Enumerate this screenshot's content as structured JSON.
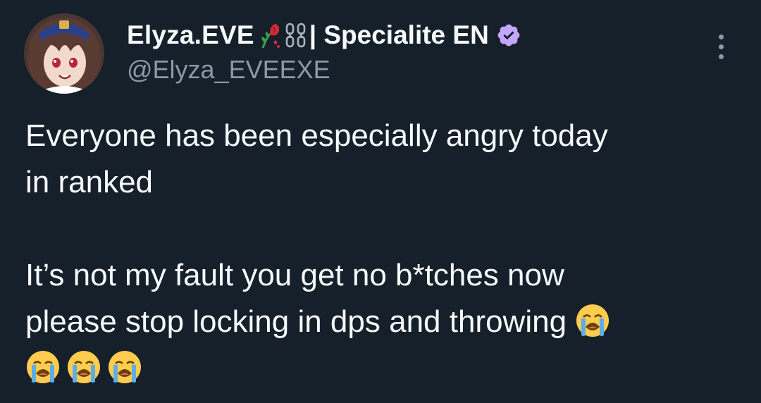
{
  "author": {
    "display_name": "Elyza.EVE",
    "name_suffix": "| Specialite EN",
    "handle": "@Elyza_EVEEXE",
    "verified": true,
    "name_emojis": [
      "wilted-rose-icon",
      "chains-icon"
    ]
  },
  "tweet": {
    "line1": "Everyone has been especially angry today",
    "line2": "in ranked",
    "line3": "It’s not my fault you get no b*tches now",
    "line4": "please stop locking in dps and throwing",
    "trailing_emoji": "loudly-crying-face",
    "trailing_emoji_count": 4
  },
  "colors": {
    "background": "#15202b",
    "text_primary": "#f7f9f9",
    "text_secondary": "#8b98a5",
    "verified_badge": "#c4a6ff"
  }
}
